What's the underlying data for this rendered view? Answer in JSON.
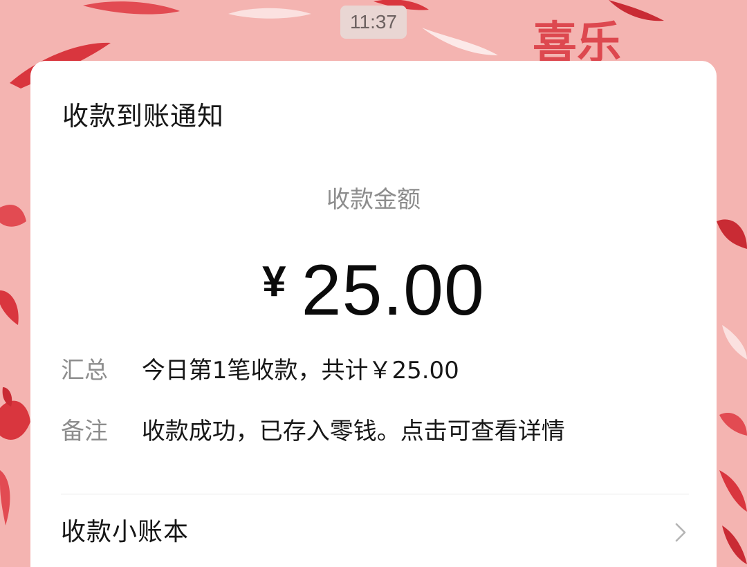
{
  "status_bar": {
    "time": "11:37"
  },
  "background": {
    "watermark_text": "喜乐",
    "accent_color": "#d9363e"
  },
  "card": {
    "title": "收款到账通知",
    "amount_label": "收款金额",
    "currency_symbol": "¥",
    "amount_value": "25.00",
    "summary": {
      "label": "汇总",
      "value": "今日第1笔收款，共计￥25.00"
    },
    "note": {
      "label": "备注",
      "value": "收款成功，已存入零钱。点击可查看详情"
    },
    "ledger_link": {
      "label": "收款小账本",
      "icon": "chevron-right-icon"
    }
  }
}
